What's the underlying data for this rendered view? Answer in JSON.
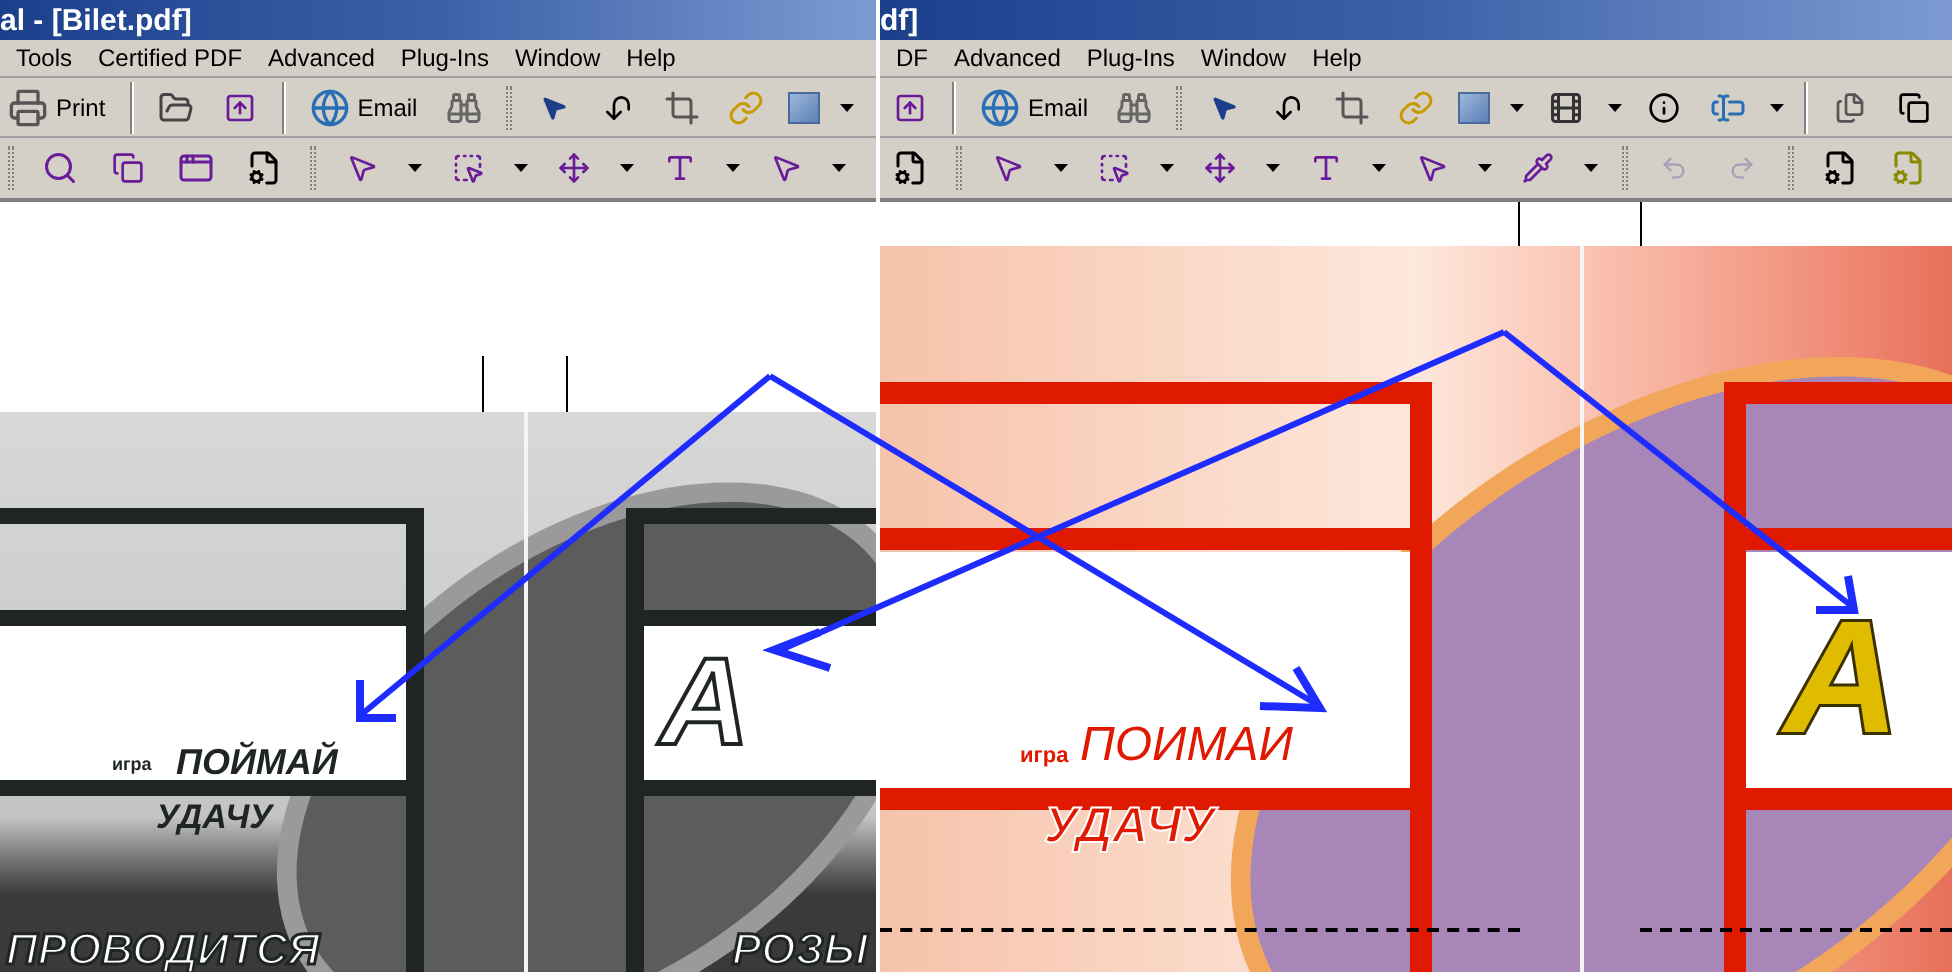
{
  "windows": [
    {
      "title": "al - [Bilet.pdf]",
      "menu": [
        "Tools",
        "Certified PDF",
        "Advanced",
        "Plug-Ins",
        "Window",
        "Help"
      ],
      "buttons": [
        "Print",
        "Email"
      ],
      "ticket": {
        "grayscale": true,
        "small_label": "игра",
        "headline": "ПОЙМАЙ",
        "subline": "УДАЧУ",
        "letter": "A",
        "footer": "ПРОВОДИТСЯ",
        "footer_2": "РОЗЫ"
      }
    },
    {
      "title": "df]",
      "menu": [
        "DF",
        "Advanced",
        "Plug-Ins",
        "Window",
        "Help"
      ],
      "buttons": [
        "Email"
      ],
      "ticket": {
        "grayscale": false,
        "small_label": "игра",
        "headline": "ПОИМАИ",
        "subline": "УДАЧУ",
        "letter": "A"
      }
    }
  ]
}
